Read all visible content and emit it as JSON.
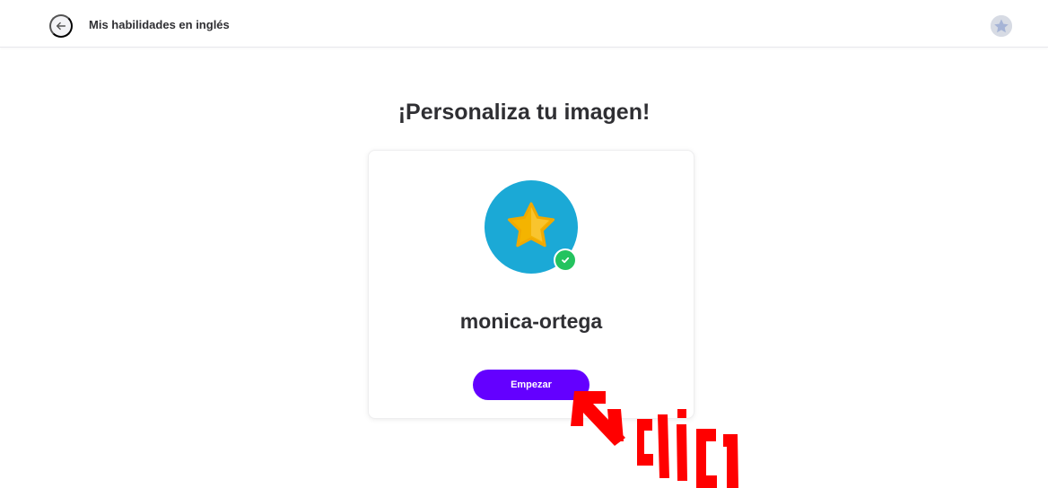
{
  "header": {
    "back_icon": "arrow-left-icon",
    "title": "Mis habilidades en inglés",
    "profile_icon": "profile-avatar-icon"
  },
  "main": {
    "title": "¡Personaliza tu imagen!",
    "card": {
      "avatar_icon": "star-icon",
      "verified_icon": "check-icon",
      "username": "monica-ortega",
      "start_button_label": "Empezar"
    }
  },
  "annotation": {
    "text": "clic",
    "arrow_icon": "red-arrow-icon"
  },
  "colors": {
    "accent": "#6400ff",
    "avatar_background": "#1ba9d6",
    "star": "#f4b400",
    "verified": "#24c35f",
    "annotation": "#ff0000"
  }
}
